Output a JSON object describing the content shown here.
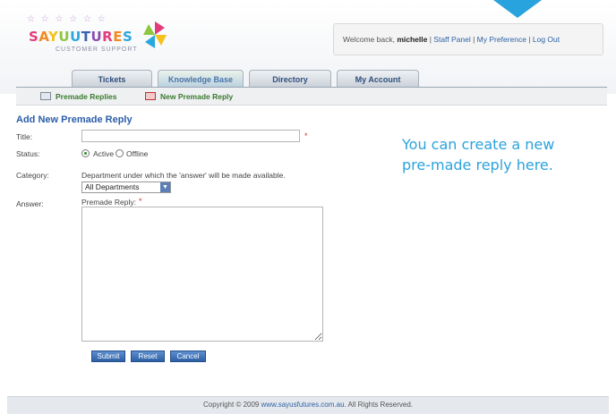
{
  "logo": {
    "wordmark": "SAYUUTURES",
    "tagline": "CUSTOMER SUPPORT",
    "stars": "☆ ☆ ☆ ☆ ☆ ☆"
  },
  "welcome": {
    "prefix": "Welcome back,",
    "user": "michelle",
    "links": [
      "Staff Panel",
      "My Preference",
      "Log Out"
    ]
  },
  "tabs": [
    "Tickets",
    "Knowledge Base",
    "Directory",
    "My Account"
  ],
  "active_tab": "Knowledge Base",
  "subnav": {
    "replies_link": "Premade Replies",
    "new_link": "New Premade Reply"
  },
  "form": {
    "heading": "Add New Premade Reply",
    "title_label": "Title:",
    "title_value": "",
    "status_label": "Status:",
    "status_options": [
      "Active",
      "Offline"
    ],
    "status_selected": "Active",
    "category_label": "Category:",
    "category_help": "Department under which the 'answer' will be made available.",
    "category_value": "All Departments",
    "answer_label": "Answer:",
    "answer_caption": "Premade Reply:",
    "answer_value": "",
    "buttons": [
      "Submit",
      "Reset",
      "Cancel"
    ]
  },
  "callout": {
    "line1": "You can create a new",
    "line2": "pre-made reply here."
  },
  "footer": {
    "prefix": "Copyright © 2009",
    "link": "www.sayusfutures.com.au",
    "suffix": ". All Rights Reserved."
  },
  "colors": {
    "accent": "#29a3dd",
    "heading": "#2b5da8",
    "button": "#2e5fa5",
    "link_green": "#3a7a2e"
  }
}
